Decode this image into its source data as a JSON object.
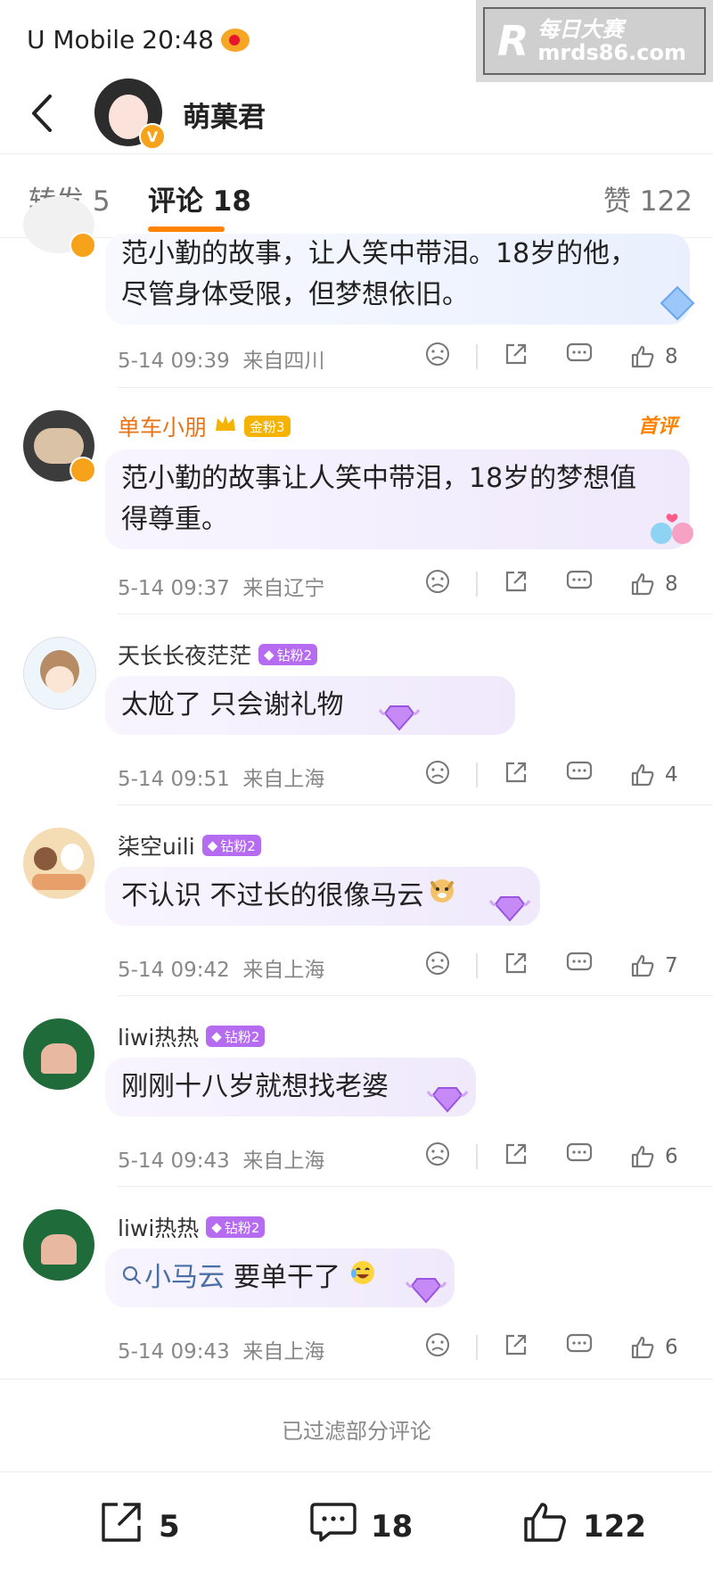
{
  "status": {
    "carrier": "U Mobile",
    "time": "20:48"
  },
  "watermark": {
    "logo": "R",
    "line1": "每日大赛",
    "line2": "mrds86.com"
  },
  "header": {
    "name": "萌菓君",
    "verified": "V"
  },
  "tabs": [
    {
      "label": "转发 5"
    },
    {
      "label": "评论 18"
    },
    {
      "label": "赞 122"
    }
  ],
  "comments": [
    {
      "name": "",
      "badge": "",
      "text": "范小勤的故事，让人笑中带泪。18岁的他，\n尽管身体受限，但梦想依旧。",
      "date": "5-14 09:39",
      "location": "来自四川",
      "likes": "8"
    },
    {
      "name": "单车小朋",
      "badge": "金粉3",
      "tag": "首评",
      "text": "范小勤的故事让人笑中带泪，18岁的梦想值\n得尊重。",
      "date": "5-14 09:37",
      "location": "来自辽宁",
      "likes": "8"
    },
    {
      "name": "天长长夜茫茫",
      "badge": "钻粉2",
      "text": "太尬了 只会谢礼物",
      "date": "5-14 09:51",
      "location": "来自上海",
      "likes": "4"
    },
    {
      "name": "柒空uili",
      "badge": "钻粉2",
      "text": "不认识 不过长的很像马云",
      "date": "5-14 09:42",
      "location": "来自上海",
      "likes": "7"
    },
    {
      "name": "liwi热热",
      "badge": "钻粉2",
      "text": "刚刚十八岁就想找老婆",
      "date": "5-14 09:43",
      "location": "来自上海",
      "likes": "6"
    },
    {
      "name": "liwi热热",
      "badge": "钻粉2",
      "mention": "小马云",
      "text": "要单干了",
      "date": "5-14 09:43",
      "location": "来自上海",
      "likes": "6"
    }
  ],
  "filter_note": "已过滤部分评论",
  "bottom_bar": {
    "reposts": "5",
    "comments": "18",
    "likes": "122"
  },
  "colors": {
    "accent": "#ff8200",
    "badge_diamond": "#b56cf0",
    "badge_gold": "#f5b300",
    "name_orange": "#e8741a",
    "mention_blue": "#4a6fa5"
  }
}
